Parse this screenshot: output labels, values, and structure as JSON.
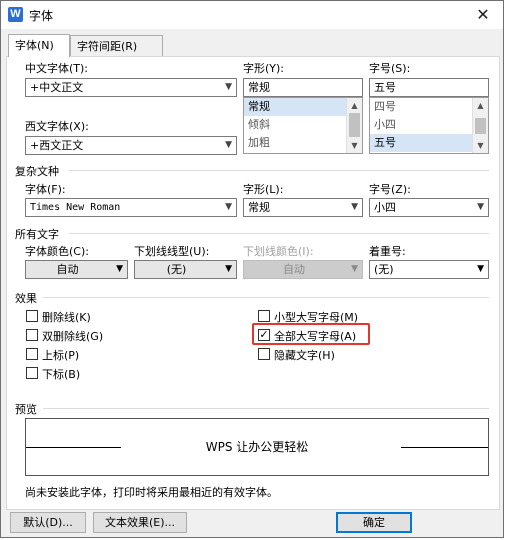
{
  "window": {
    "title": "字体",
    "app_icon": "W"
  },
  "tabs": [
    {
      "label": "字体(N)",
      "active": true
    },
    {
      "label": "字符间距(R)",
      "active": false
    }
  ],
  "chinese_font": {
    "label": "中文字体(T):",
    "value": "+中文正文"
  },
  "style": {
    "label": "字形(Y):",
    "value": "常规",
    "options": [
      {
        "label": "常规",
        "selected": true
      },
      {
        "label": "倾斜",
        "selected": false
      },
      {
        "label": "加粗",
        "selected": false
      }
    ]
  },
  "size": {
    "label": "字号(S):",
    "value": "五号",
    "options": [
      {
        "label": "四号",
        "selected": false
      },
      {
        "label": "小四",
        "selected": false
      },
      {
        "label": "五号",
        "selected": true
      }
    ]
  },
  "western_font": {
    "label": "西文字体(X):",
    "value": "+西文正文"
  },
  "complex": {
    "section": "复杂文种",
    "font_label": "字体(F):",
    "font_value": "Times New Roman",
    "style_label": "字形(L):",
    "style_value": "常规",
    "size_label": "字号(Z):",
    "size_value": "小四"
  },
  "all_text": {
    "section": "所有文字",
    "color_label": "字体颜色(C):",
    "color_value": "自动",
    "underline_type_label": "下划线线型(U):",
    "underline_type_value": "(无)",
    "underline_color_label": "下划线颜色(I):",
    "underline_color_value": "自动",
    "emphasis_label": "着重号:",
    "emphasis_value": "(无)"
  },
  "effects": {
    "section": "效果",
    "items": [
      {
        "label": "删除线(K)",
        "checked": false
      },
      {
        "label": "双删除线(G)",
        "checked": false
      },
      {
        "label": "上标(P)",
        "checked": false
      },
      {
        "label": "下标(B)",
        "checked": false
      },
      {
        "label": "小型大写字母(M)",
        "checked": false
      },
      {
        "label": "全部大写字母(A)",
        "checked": true
      },
      {
        "label": "隐藏文字(H)",
        "checked": false
      }
    ]
  },
  "preview": {
    "section": "预览",
    "sample_text": "WPS 让办公更轻松"
  },
  "status_text": "尚未安装此字体，打印时将采用最相近的有效字体。",
  "buttons": {
    "default": "默认(D)...",
    "text_effects": "文本效果(E)...",
    "ok": "确定"
  },
  "colors": {
    "highlight": "#e2372a",
    "selection": "#d5e5f6",
    "app_icon": "#2b6fd6"
  }
}
